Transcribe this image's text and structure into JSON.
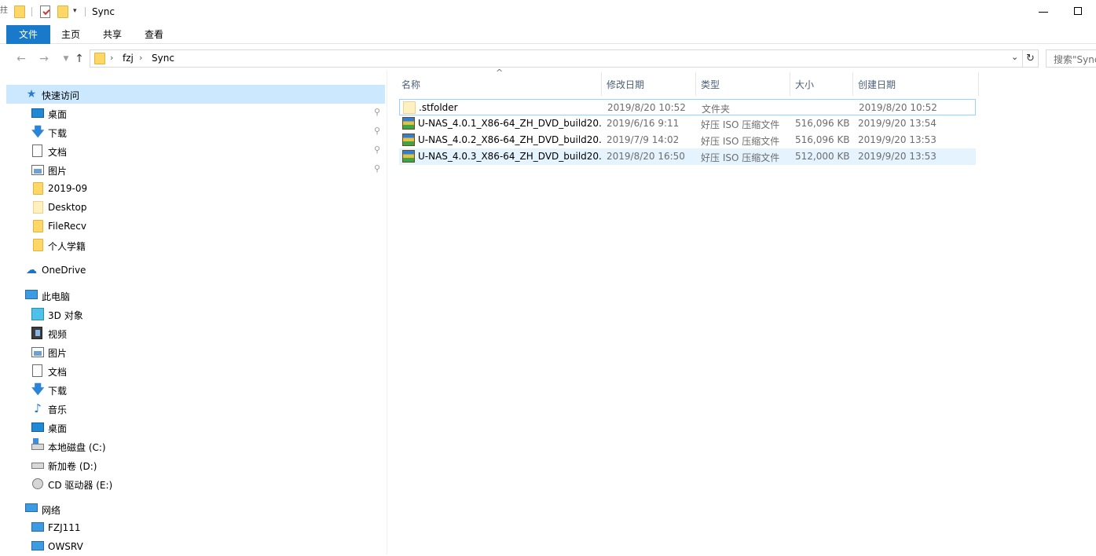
{
  "window": {
    "title": "Sync",
    "left_glyph": "拄"
  },
  "quick_access": {
    "dropdown": "▾"
  },
  "ribbon": {
    "tabs": [
      {
        "label": "文件"
      },
      {
        "label": "主页"
      },
      {
        "label": "共享"
      },
      {
        "label": "查看"
      }
    ]
  },
  "address": {
    "breadcrumbs": [
      "fzj",
      "Sync"
    ],
    "search_placeholder": "搜索\"Sync\""
  },
  "nav": {
    "quick_access": {
      "label": "快速访问",
      "items": [
        {
          "label": "桌面",
          "pinned": true,
          "icon": "desktop-icon"
        },
        {
          "label": "下载",
          "pinned": true,
          "icon": "download-icon"
        },
        {
          "label": "文档",
          "pinned": true,
          "icon": "document-icon"
        },
        {
          "label": "图片",
          "pinned": true,
          "icon": "picture-icon"
        },
        {
          "label": "2019-09",
          "pinned": false,
          "icon": "folder-icon"
        },
        {
          "label": "Desktop",
          "pinned": false,
          "icon": "folder-icon"
        },
        {
          "label": "FileRecv",
          "pinned": false,
          "icon": "folder-icon"
        },
        {
          "label": "个人学籍",
          "pinned": false,
          "icon": "folder-icon"
        }
      ]
    },
    "onedrive": {
      "label": "OneDrive"
    },
    "this_pc": {
      "label": "此电脑",
      "items": [
        {
          "label": "3D 对象",
          "icon": "3d-objects-icon"
        },
        {
          "label": "视频",
          "icon": "video-icon"
        },
        {
          "label": "图片",
          "icon": "picture-icon"
        },
        {
          "label": "文档",
          "icon": "document-icon"
        },
        {
          "label": "下载",
          "icon": "download-icon"
        },
        {
          "label": "音乐",
          "icon": "music-icon"
        },
        {
          "label": "桌面",
          "icon": "desktop-icon"
        },
        {
          "label": "本地磁盘 (C:)",
          "icon": "local-disk-icon"
        },
        {
          "label": "新加卷 (D:)",
          "icon": "drive-icon"
        },
        {
          "label": "CD 驱动器 (E:)",
          "icon": "cd-drive-icon"
        }
      ]
    },
    "network": {
      "label": "网络",
      "items": [
        {
          "label": "FZJ111"
        },
        {
          "label": "OWSRV"
        }
      ]
    }
  },
  "columns": [
    "名称",
    "修改日期",
    "类型",
    "大小",
    "创建日期"
  ],
  "files": [
    {
      "name": ".stfolder",
      "modified": "2019/8/20 10:52",
      "type": "文件夹",
      "size": "",
      "created": "2019/8/20 10:52",
      "icon": "folder-icon"
    },
    {
      "name": "U-NAS_4.0.1_X86-64_ZH_DVD_build20...",
      "modified": "2019/6/16 9:11",
      "type": "好压 ISO 压缩文件",
      "size": "516,096 KB",
      "created": "2019/9/20 13:54",
      "icon": "iso-archive-icon"
    },
    {
      "name": "U-NAS_4.0.2_X86-64_ZH_DVD_build20...",
      "modified": "2019/7/9 14:02",
      "type": "好压 ISO 压缩文件",
      "size": "516,096 KB",
      "created": "2019/9/20 13:53",
      "icon": "iso-archive-icon"
    },
    {
      "name": "U-NAS_4.0.3_X86-64_ZH_DVD_build20...",
      "modified": "2019/8/20 16:50",
      "type": "好压 ISO 压缩文件",
      "size": "512,000 KB",
      "created": "2019/9/20 13:53",
      "icon": "iso-archive-icon"
    }
  ]
}
